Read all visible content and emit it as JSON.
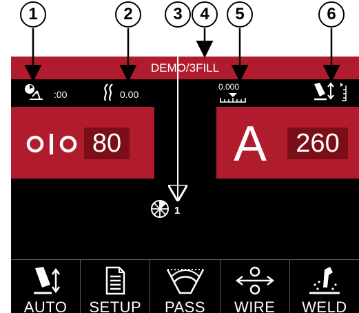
{
  "callouts": [
    "1",
    "2",
    "3",
    "4",
    "5",
    "6"
  ],
  "header": {
    "title": "DEMO/3FILL"
  },
  "status": {
    "timer_value": ":00",
    "heat_value": "0.00",
    "offset_value": "0.000"
  },
  "left_panel": {
    "value": "80",
    "icon": "wire-feed-speed-icon"
  },
  "right_panel": {
    "unit": "A",
    "value": "260"
  },
  "pass": {
    "count": "1",
    "icon": "pass-sequence-icon"
  },
  "bottom_nav": {
    "items": [
      {
        "label": "AUTO",
        "icon": "torch-height-auto-icon"
      },
      {
        "label": "SETUP",
        "icon": "document-icon"
      },
      {
        "label": "PASS",
        "icon": "weld-pass-icon"
      },
      {
        "label": "WIRE",
        "icon": "wire-feed-icon"
      },
      {
        "label": "WELD",
        "icon": "welding-torch-icon"
      }
    ]
  },
  "colors": {
    "accent": "#b01c2e",
    "value_box": "#7a0f18",
    "background": "#000000"
  }
}
